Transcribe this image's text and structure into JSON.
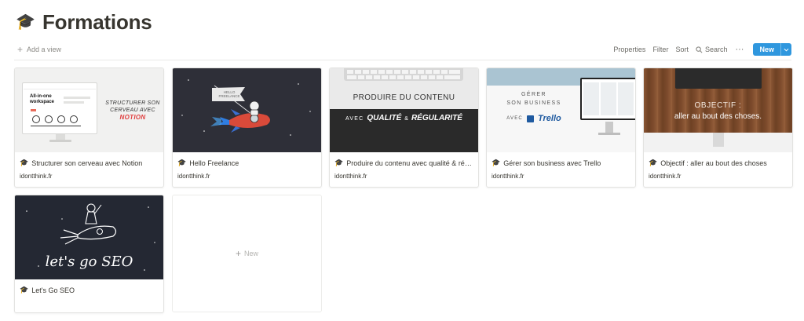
{
  "page": {
    "title": "Formations",
    "title_icon": "graduation-cap-icon",
    "title_emoji": "🎓"
  },
  "toolbar": {
    "add_view": "Add a view",
    "properties": "Properties",
    "filter": "Filter",
    "sort": "Sort",
    "search": "Search",
    "more": "···",
    "new": "New"
  },
  "cards": [
    {
      "title": "Structurer son cerveau avec Notion",
      "url": "idontthink.fr",
      "cover": {
        "headline": "All-in-one workspace",
        "lines": [
          "STRUCTURER SON",
          "CERVEAU AVEC"
        ],
        "highlight": "NOTION"
      }
    },
    {
      "title": "Hello Freelance",
      "url": "idontthink.fr",
      "cover": {
        "flag_lines": [
          "HELLO",
          "FREELANCE"
        ]
      }
    },
    {
      "title": "Produire du contenu avec qualité & rég…",
      "url": "idontthink.fr",
      "cover": {
        "line1": "PRODUIRE DU CONTENU",
        "avec": "AVEC",
        "qualite": "QUALITÉ",
        "amp": "&",
        "regularite": "RÉGULARITÉ"
      }
    },
    {
      "title": "Gérer son business avec Trello",
      "url": "idontthink.fr",
      "cover": {
        "line1": "GÉRER",
        "line2": "SON BUSINESS",
        "avec": "AVEC",
        "brand": "Trello"
      }
    },
    {
      "title": "Objectif : aller au bout des choses",
      "url": "idontthink.fr",
      "cover": {
        "line1": "OBJECTIF :",
        "line2": "aller au bout des choses."
      }
    },
    {
      "title": "Let's Go SEO",
      "url": "",
      "cover": {
        "text": "let's go SEO"
      }
    }
  ],
  "new_card": {
    "label": "New"
  },
  "colors": {
    "accent": "#2f97de",
    "notion_red": "#e03e3e"
  }
}
